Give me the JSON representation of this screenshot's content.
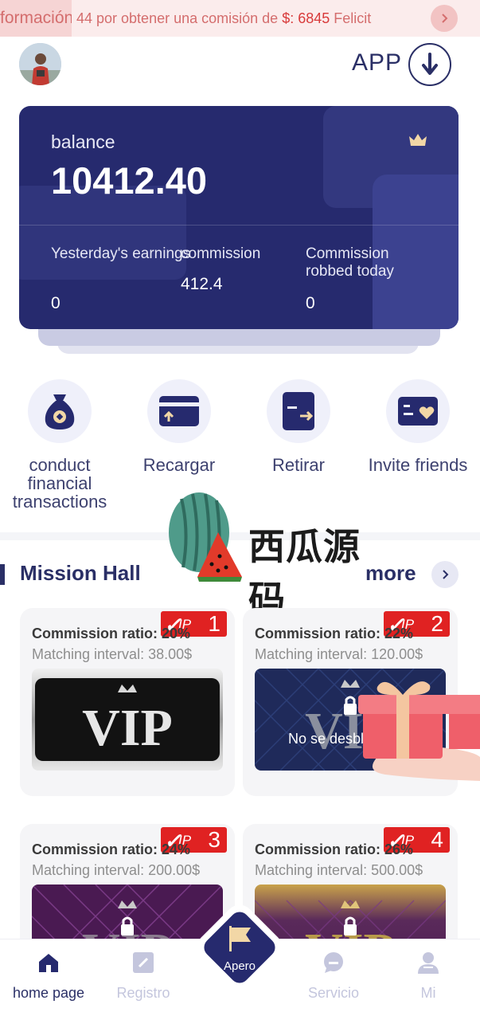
{
  "marquee": {
    "left_text": "formación",
    "prefix": "44 por obtener una comisión de",
    "currency": "$:",
    "amount": "6845",
    "suffix": "Felicit"
  },
  "header": {
    "app_label": "APP"
  },
  "balance": {
    "label": "balance",
    "value": "10412.40",
    "stats": [
      {
        "label": "Yesterday's earnings",
        "value": "0"
      },
      {
        "label": "commission",
        "value": "412.4"
      },
      {
        "label": "Commission robbed today",
        "value": "0"
      }
    ]
  },
  "actions": [
    {
      "label": "conduct financial transactions",
      "icon": "money-bag-icon"
    },
    {
      "label": "Recargar",
      "icon": "card-deposit-icon"
    },
    {
      "label": "Retirar",
      "icon": "withdraw-icon"
    },
    {
      "label": "Invite friends",
      "icon": "invite-card-icon"
    }
  ],
  "watermark": {
    "text": "西瓜源码"
  },
  "mission_hall": {
    "title": "Mission Hall",
    "more": "more",
    "cards": [
      {
        "badge_num": "1",
        "badge_tag": "IP",
        "ratio": "Commission ratio:  20%",
        "interval": "Matching interval:  38.00$",
        "locked": "",
        "theme": "silver"
      },
      {
        "badge_num": "2",
        "badge_tag": "IP",
        "ratio": "Commission ratio:  22%",
        "interval": "Matching interval:  120.00$",
        "locked": "No se desbl",
        "theme": "blue"
      },
      {
        "badge_num": "3",
        "badge_tag": "IP",
        "ratio": "Commission ratio:  24%",
        "interval": "Matching interval:  200.00$",
        "locked": "",
        "theme": "purple"
      },
      {
        "badge_num": "4",
        "badge_tag": "IP",
        "ratio": "Commission ratio:  26%",
        "interval": "Matching interval:  500.00$",
        "locked": "",
        "theme": "gold"
      }
    ]
  },
  "nav": {
    "items": [
      {
        "label": "home page",
        "icon": "home-icon"
      },
      {
        "label": "Registro",
        "icon": "edit-icon"
      },
      {
        "label": "Apero",
        "icon": "flag-icon"
      },
      {
        "label": "Servicio",
        "icon": "chat-icon"
      },
      {
        "label": "Mi",
        "icon": "user-icon"
      }
    ]
  },
  "colors": {
    "primary": "#262a6e",
    "badge": "#e02222",
    "marquee_bg": "#fbecec",
    "marquee_text": "#d46d6d"
  }
}
